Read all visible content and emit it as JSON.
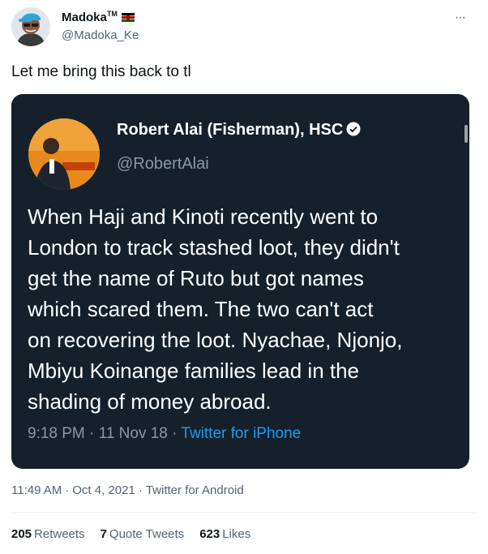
{
  "author": {
    "display_name": "Madoka",
    "trademark": "TM",
    "handle": "@Madoka_Ke",
    "avatar_icon": "cartoon-avatar-icon",
    "flag_icon": "kenya-flag-icon"
  },
  "more_icon": "more-options-icon",
  "tweet_text": "Let me bring this back to tl",
  "embedded": {
    "display_name": "Robert Alai (Fisherman), HSC",
    "handle": "@RobertAlai",
    "verified_icon": "verified-badge-icon",
    "text": "When Haji and Kinoti recently went to\nLondon to track stashed loot, they didn't\nget the name of Ruto but got names\nwhich scared them. The two can't act\non recovering the loot. Nyachae, Njonjo,\nMbiyu Koinange families lead in the\nshading of money abroad.",
    "time": "9:18 PM",
    "date": "11 Nov 18",
    "source": "Twitter for iPhone"
  },
  "timestamp": {
    "time": "11:49 AM",
    "date": "Oct 4, 2021",
    "source": "Twitter for Android",
    "separator": "·"
  },
  "stats": {
    "retweets_count": "205",
    "retweets_label": "Retweets",
    "quotes_count": "7",
    "quotes_label": "Quote Tweets",
    "likes_count": "623",
    "likes_label": "Likes"
  },
  "colors": {
    "link_blue": "#1d9bf0",
    "embedded_bg": "#15202b",
    "secondary_text": "#536471"
  }
}
